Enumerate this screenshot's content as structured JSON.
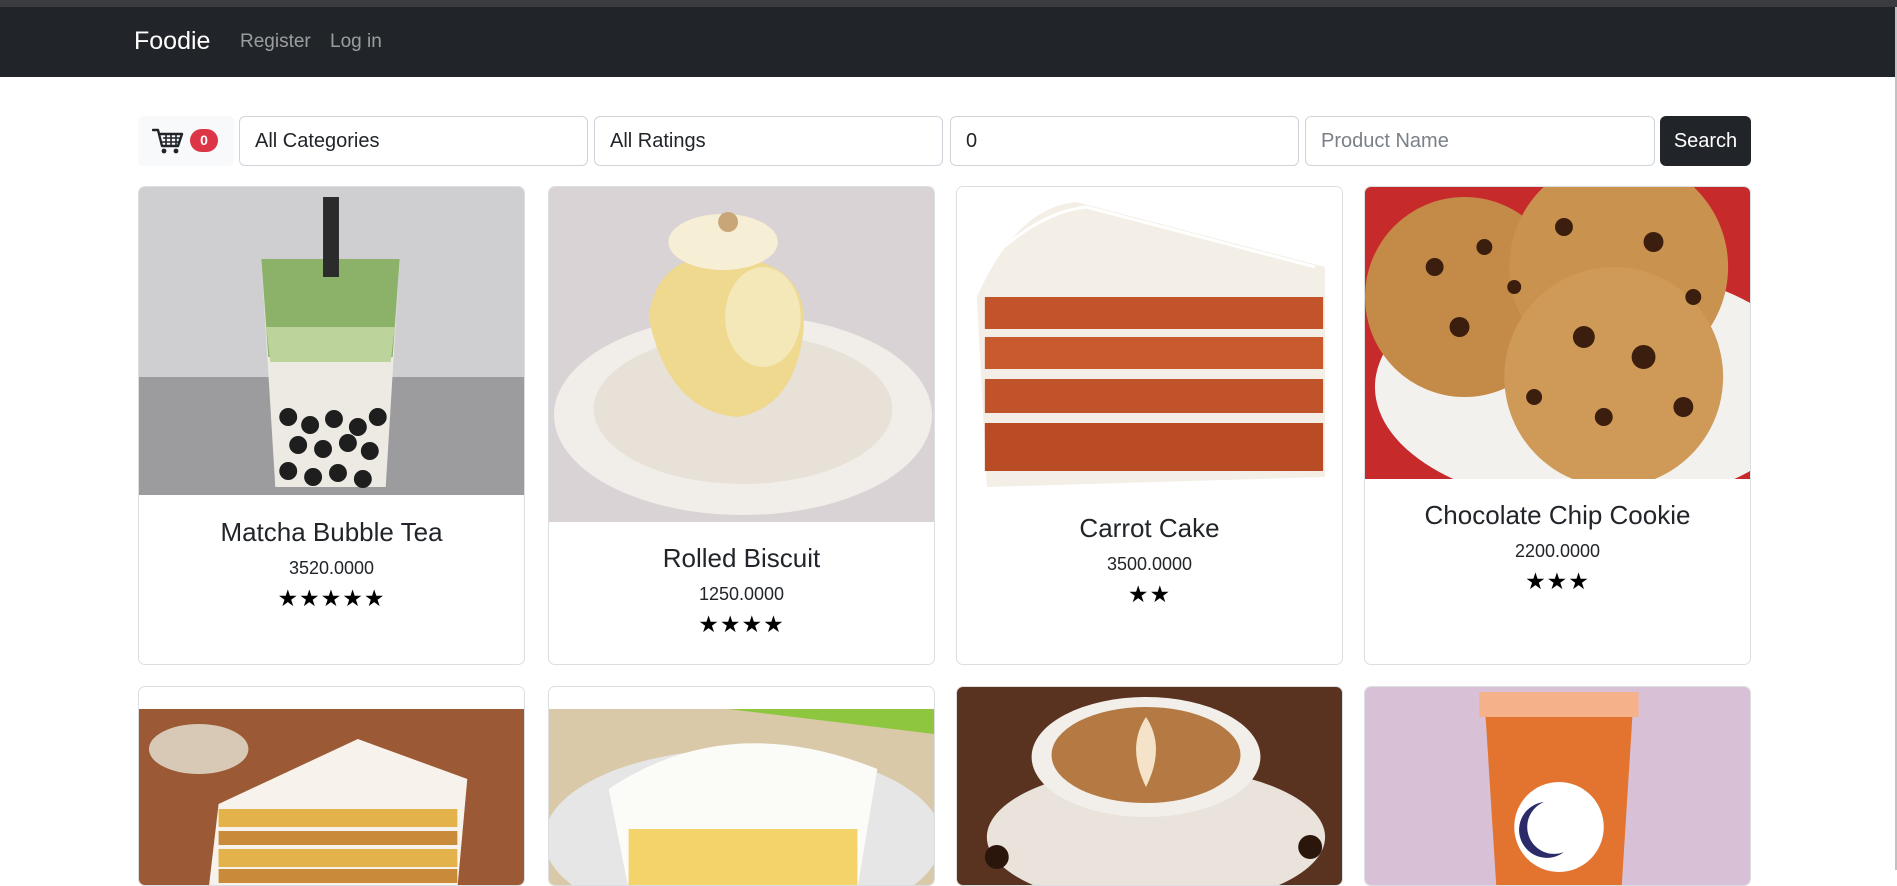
{
  "nav": {
    "brand": "Foodie",
    "register": "Register",
    "login": "Log in"
  },
  "cart": {
    "count": "0",
    "icon": "cart-icon"
  },
  "filters": {
    "category": "All Categories",
    "rating": "All Ratings",
    "price": "0",
    "name_placeholder": "Product Name",
    "search": "Search"
  },
  "products": [
    {
      "name": "Matcha Bubble Tea",
      "price": "3520.0000",
      "stars": "★★★★★",
      "rating": 5
    },
    {
      "name": "Rolled Biscuit",
      "price": "1250.0000",
      "stars": "★★★★",
      "rating": 4
    },
    {
      "name": "Carrot Cake",
      "price": "3500.0000",
      "stars": "★★",
      "rating": 2
    },
    {
      "name": "Chocolate Chip Cookie",
      "price": "2200.0000",
      "stars": "★★★",
      "rating": 3
    }
  ],
  "colors": {
    "navbar": "#212529",
    "badge": "#dc3545",
    "search_button": "#212529"
  }
}
